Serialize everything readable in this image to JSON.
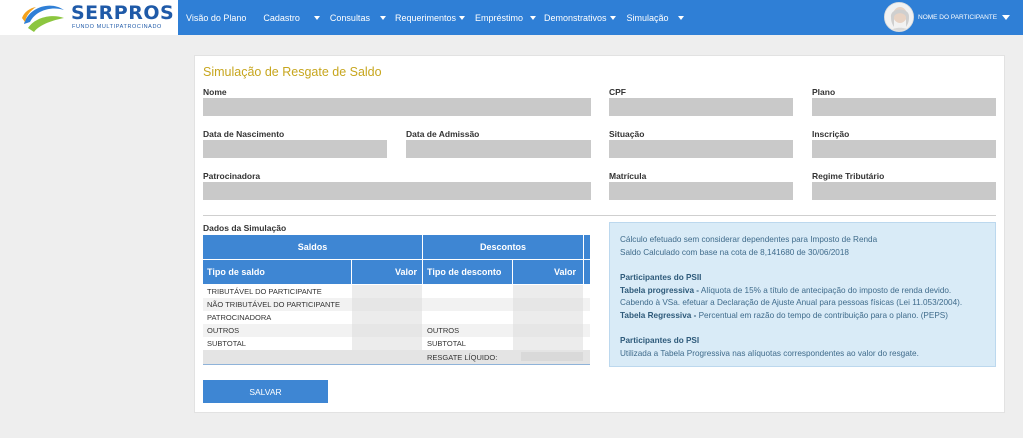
{
  "brand": {
    "name": "SERPROS",
    "subtitle": "FUNDO MULTIPATROCINADO"
  },
  "nav": {
    "items": [
      {
        "label": "Visão do Plano",
        "has_menu": false
      },
      {
        "label": "Cadastro",
        "has_menu": true
      },
      {
        "label": "Consultas",
        "has_menu": true
      },
      {
        "label": "Requerimentos",
        "has_menu": true
      },
      {
        "label": "Empréstimo",
        "has_menu": true
      },
      {
        "label": "Demonstrativos",
        "has_menu": true
      },
      {
        "label": "Simulação",
        "has_menu": true
      }
    ],
    "user_name": "NOME DO PARTICIPANTE"
  },
  "page": {
    "title": "Simulação de Resgate de Saldo",
    "fields": {
      "nome": "Nome",
      "cpf": "CPF",
      "plano": "Plano",
      "nascimento": "Data de Nascimento",
      "admissao": "Data de Admissão",
      "situacao": "Situação",
      "inscricao": "Inscrição",
      "patrocinadora": "Patrocinadora",
      "matricula": "Matrícula",
      "regime": "Regime Tributário"
    },
    "simulation_title": "Dados da Simulação",
    "table": {
      "group_saldos": "Saldos",
      "group_descontos": "Descontos",
      "col_tipo_saldo": "Tipo de saldo",
      "col_valor": "Valor",
      "col_tipo_desconto": "Tipo de desconto",
      "rows": [
        {
          "saldo": "TRIBUTÁVEL DO PARTICIPANTE",
          "desconto": ""
        },
        {
          "saldo": "NÃO TRIBUTÁVEL DO PARTICIPANTE",
          "desconto": ""
        },
        {
          "saldo": "PATROCINADORA",
          "desconto": ""
        },
        {
          "saldo": "OUTROS",
          "desconto": "OUTROS"
        },
        {
          "saldo": "SUBTOTAL",
          "desconto": "SUBTOTAL"
        }
      ],
      "resgate_label": "RESGATE LÍQUIDO:"
    },
    "save_label": "SALVAR",
    "info": {
      "line1": "Cálculo efetuado sem considerar dependentes para Imposto de Renda",
      "line2": "Saldo Calculado com base na cota de 8,141680 de 30/06/2018",
      "psii_title": "Participantes do PSII",
      "prog_label": "Tabela progressiva -",
      "prog_text": " Alíquota de 15% a título de antecipação do imposto de renda devido.",
      "prog_text2": "Cabendo à VSa. efetuar a Declaração de Ajuste Anual para pessoas físicas (Lei 11.053/2004).",
      "reg_label": "Tabela Regressiva -",
      "reg_text": " Percentual em razão do tempo de contribuição para o plano. (PEPS)",
      "psi_title": "Participantes do PSI",
      "psi_text": "Utilizada a Tabela Progressiva nas alíquotas correspondentes ao valor do resgate."
    }
  },
  "colors": {
    "primary": "#2f7fd6",
    "table_header": "#3e86d3",
    "title": "#c7a61e",
    "field": "#c9c9c9",
    "info_bg": "#d9ebf7"
  }
}
